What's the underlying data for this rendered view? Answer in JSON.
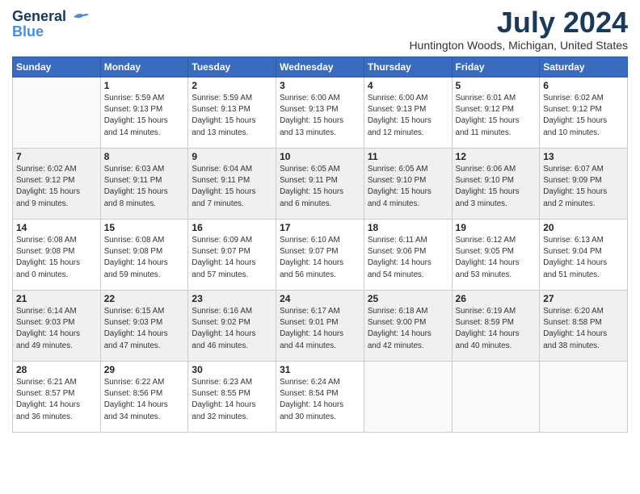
{
  "header": {
    "logo_line1": "General",
    "logo_line2": "Blue",
    "month_title": "July 2024",
    "location": "Huntington Woods, Michigan, United States"
  },
  "weekdays": [
    "Sunday",
    "Monday",
    "Tuesday",
    "Wednesday",
    "Thursday",
    "Friday",
    "Saturday"
  ],
  "weeks": [
    [
      {
        "day": "",
        "info": ""
      },
      {
        "day": "1",
        "info": "Sunrise: 5:59 AM\nSunset: 9:13 PM\nDaylight: 15 hours\nand 14 minutes."
      },
      {
        "day": "2",
        "info": "Sunrise: 5:59 AM\nSunset: 9:13 PM\nDaylight: 15 hours\nand 13 minutes."
      },
      {
        "day": "3",
        "info": "Sunrise: 6:00 AM\nSunset: 9:13 PM\nDaylight: 15 hours\nand 13 minutes."
      },
      {
        "day": "4",
        "info": "Sunrise: 6:00 AM\nSunset: 9:13 PM\nDaylight: 15 hours\nand 12 minutes."
      },
      {
        "day": "5",
        "info": "Sunrise: 6:01 AM\nSunset: 9:12 PM\nDaylight: 15 hours\nand 11 minutes."
      },
      {
        "day": "6",
        "info": "Sunrise: 6:02 AM\nSunset: 9:12 PM\nDaylight: 15 hours\nand 10 minutes."
      }
    ],
    [
      {
        "day": "7",
        "info": "Sunrise: 6:02 AM\nSunset: 9:12 PM\nDaylight: 15 hours\nand 9 minutes."
      },
      {
        "day": "8",
        "info": "Sunrise: 6:03 AM\nSunset: 9:11 PM\nDaylight: 15 hours\nand 8 minutes."
      },
      {
        "day": "9",
        "info": "Sunrise: 6:04 AM\nSunset: 9:11 PM\nDaylight: 15 hours\nand 7 minutes."
      },
      {
        "day": "10",
        "info": "Sunrise: 6:05 AM\nSunset: 9:11 PM\nDaylight: 15 hours\nand 6 minutes."
      },
      {
        "day": "11",
        "info": "Sunrise: 6:05 AM\nSunset: 9:10 PM\nDaylight: 15 hours\nand 4 minutes."
      },
      {
        "day": "12",
        "info": "Sunrise: 6:06 AM\nSunset: 9:10 PM\nDaylight: 15 hours\nand 3 minutes."
      },
      {
        "day": "13",
        "info": "Sunrise: 6:07 AM\nSunset: 9:09 PM\nDaylight: 15 hours\nand 2 minutes."
      }
    ],
    [
      {
        "day": "14",
        "info": "Sunrise: 6:08 AM\nSunset: 9:08 PM\nDaylight: 15 hours\nand 0 minutes."
      },
      {
        "day": "15",
        "info": "Sunrise: 6:08 AM\nSunset: 9:08 PM\nDaylight: 14 hours\nand 59 minutes."
      },
      {
        "day": "16",
        "info": "Sunrise: 6:09 AM\nSunset: 9:07 PM\nDaylight: 14 hours\nand 57 minutes."
      },
      {
        "day": "17",
        "info": "Sunrise: 6:10 AM\nSunset: 9:07 PM\nDaylight: 14 hours\nand 56 minutes."
      },
      {
        "day": "18",
        "info": "Sunrise: 6:11 AM\nSunset: 9:06 PM\nDaylight: 14 hours\nand 54 minutes."
      },
      {
        "day": "19",
        "info": "Sunrise: 6:12 AM\nSunset: 9:05 PM\nDaylight: 14 hours\nand 53 minutes."
      },
      {
        "day": "20",
        "info": "Sunrise: 6:13 AM\nSunset: 9:04 PM\nDaylight: 14 hours\nand 51 minutes."
      }
    ],
    [
      {
        "day": "21",
        "info": "Sunrise: 6:14 AM\nSunset: 9:03 PM\nDaylight: 14 hours\nand 49 minutes."
      },
      {
        "day": "22",
        "info": "Sunrise: 6:15 AM\nSunset: 9:03 PM\nDaylight: 14 hours\nand 47 minutes."
      },
      {
        "day": "23",
        "info": "Sunrise: 6:16 AM\nSunset: 9:02 PM\nDaylight: 14 hours\nand 46 minutes."
      },
      {
        "day": "24",
        "info": "Sunrise: 6:17 AM\nSunset: 9:01 PM\nDaylight: 14 hours\nand 44 minutes."
      },
      {
        "day": "25",
        "info": "Sunrise: 6:18 AM\nSunset: 9:00 PM\nDaylight: 14 hours\nand 42 minutes."
      },
      {
        "day": "26",
        "info": "Sunrise: 6:19 AM\nSunset: 8:59 PM\nDaylight: 14 hours\nand 40 minutes."
      },
      {
        "day": "27",
        "info": "Sunrise: 6:20 AM\nSunset: 8:58 PM\nDaylight: 14 hours\nand 38 minutes."
      }
    ],
    [
      {
        "day": "28",
        "info": "Sunrise: 6:21 AM\nSunset: 8:57 PM\nDaylight: 14 hours\nand 36 minutes."
      },
      {
        "day": "29",
        "info": "Sunrise: 6:22 AM\nSunset: 8:56 PM\nDaylight: 14 hours\nand 34 minutes."
      },
      {
        "day": "30",
        "info": "Sunrise: 6:23 AM\nSunset: 8:55 PM\nDaylight: 14 hours\nand 32 minutes."
      },
      {
        "day": "31",
        "info": "Sunrise: 6:24 AM\nSunset: 8:54 PM\nDaylight: 14 hours\nand 30 minutes."
      },
      {
        "day": "",
        "info": ""
      },
      {
        "day": "",
        "info": ""
      },
      {
        "day": "",
        "info": ""
      }
    ]
  ]
}
